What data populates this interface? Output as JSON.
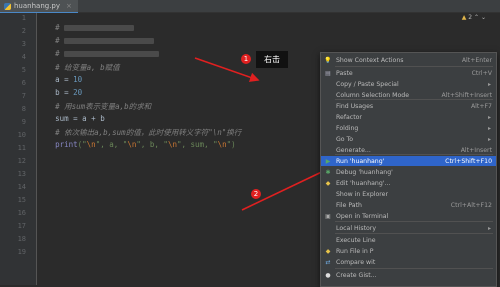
{
  "tab": {
    "filename": "huanhang.py"
  },
  "editor": {
    "line_numbers": [
      "1",
      "2",
      "3",
      "4",
      "5",
      "6",
      "7",
      "8",
      "9",
      "10",
      "11",
      "12",
      "13",
      "14",
      "15",
      "16",
      "17",
      "18",
      "19"
    ],
    "code": {
      "l4": "# 给变量a, b赋值",
      "l5_var": "a = ",
      "l5_num": "10",
      "l6_var": "b = ",
      "l6_num": "20",
      "l7": "# 用sum表示变量a,b的求和",
      "l8": "sum = a + b",
      "l9": "# 依次输出a,b,sum的值，此时使用转义字符\"\\n\"换行",
      "l10_fn": "print",
      "l10_p1": "(\"",
      "l10_esc": "\\n",
      "l10_p2": "\", a, \"",
      "l10_p3": "\", b, \"",
      "l10_p4": "\", sum, \"",
      "l10_p5": "\")"
    },
    "line2_text": "#",
    "line3_text": "#",
    "inspection": {
      "count": "2"
    }
  },
  "annotations": {
    "right_click_label": "右击",
    "step1": "1",
    "step2": "2"
  },
  "context_menu": {
    "items": [
      {
        "label": "Show Context Actions",
        "shortcut": "Alt+Enter",
        "icon": "lightbulb-icon"
      },
      {
        "label": "Paste",
        "shortcut": "Ctrl+V",
        "icon": "clipboard-icon"
      },
      {
        "label": "Copy / Paste Special",
        "shortcut": "",
        "icon": ""
      },
      {
        "label": "Column Selection Mode",
        "shortcut": "Alt+Shift+Insert",
        "icon": ""
      },
      {
        "label": "Find Usages",
        "shortcut": "Alt+F7",
        "icon": ""
      },
      {
        "label": "Refactor",
        "shortcut": "",
        "icon": ""
      },
      {
        "label": "Folding",
        "shortcut": "",
        "icon": ""
      },
      {
        "label": "Go To",
        "shortcut": "",
        "icon": ""
      },
      {
        "label": "Generate...",
        "shortcut": "Alt+Insert",
        "icon": ""
      },
      {
        "label": "Run 'huanhang'",
        "shortcut": "Ctrl+Shift+F10",
        "icon": "run-icon"
      },
      {
        "label": "Debug 'huanhang'",
        "shortcut": "",
        "icon": "debug-icon"
      },
      {
        "label": "Edit 'huanhang'...",
        "shortcut": "",
        "icon": "python-icon"
      },
      {
        "label": "Show in Explorer",
        "shortcut": "",
        "icon": ""
      },
      {
        "label": "File Path",
        "shortcut": "Ctrl+Alt+F12",
        "icon": ""
      },
      {
        "label": "Open in Terminal",
        "shortcut": "",
        "icon": "terminal-icon"
      },
      {
        "label": "Local History",
        "shortcut": "",
        "icon": ""
      },
      {
        "label": "Execute Line",
        "shortcut": "",
        "icon": ""
      },
      {
        "label": "Run File in P",
        "shortcut": "",
        "icon": "python-icon"
      },
      {
        "label": "Compare wit",
        "shortcut": "",
        "icon": "compare-icon"
      },
      {
        "label": "Create Gist...",
        "shortcut": "",
        "icon": "github-icon"
      }
    ]
  },
  "colors": {
    "accent": "#2f65ca",
    "badge": "#e02020"
  }
}
